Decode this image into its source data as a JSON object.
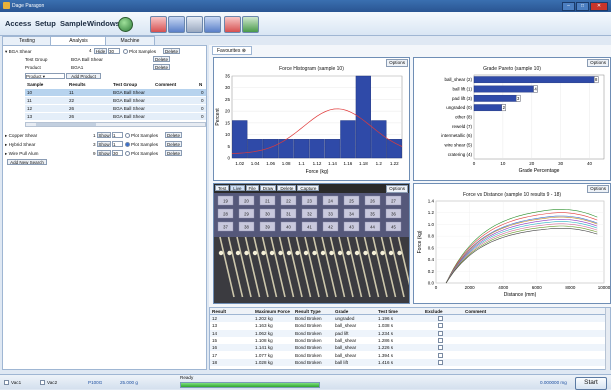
{
  "window": {
    "title": "Dage Paragon"
  },
  "menu": {
    "access": "Access",
    "setup": "Setup",
    "sample": "Sample",
    "windows": "Windows"
  },
  "tabs": {
    "testing": "Testing",
    "analysis": "Analysis",
    "machine": "Machine"
  },
  "left": {
    "group1": {
      "name": "BGA Shear",
      "count": "4",
      "hide_label": "Hide",
      "hide_value": "30",
      "plot_label": "Plot Samples",
      "delete_label": "Delete"
    },
    "test_group_label": "Test Group",
    "test_group_value": "BGA Ball Shear",
    "product_label": "Product",
    "product_value": "BGA1",
    "product_dropdown": "Product",
    "add_product": "Add Product",
    "table_headers": [
      "Sample",
      "Results",
      "Test Group",
      "Comment",
      "N"
    ],
    "rows": [
      {
        "sample": "10",
        "results": "11",
        "group": "BGA Ball Shear",
        "n": "0"
      },
      {
        "sample": "11",
        "results": "22",
        "group": "BGA Ball Shear",
        "n": "0"
      },
      {
        "sample": "12",
        "results": "26",
        "group": "BGA Ball Shear",
        "n": "0"
      },
      {
        "sample": "13",
        "results": "26",
        "group": "BGA Ball Shear",
        "n": "0"
      }
    ],
    "groups": [
      {
        "name": "Copper Shear",
        "count": "1",
        "show": "Show",
        "value": "1",
        "plot": "Plot Samples",
        "delete": "Delete"
      },
      {
        "name": "Hybrid Shear",
        "count": "3",
        "show": "Show",
        "value": "1",
        "plot": "Plot Samples",
        "delete": "Delete"
      },
      {
        "name": "Wire Pull Alum",
        "count": "9",
        "show": "Show",
        "value": "30",
        "plot": "Plot Samples",
        "delete": "Delete"
      }
    ],
    "add_new_search": "Add New Search"
  },
  "favourites_tab": "Favourites",
  "options_label": "Options",
  "hist": {
    "title": "Force Histogram (sample 10)",
    "xlabel": "Force (kg)",
    "ylabel": "Percent"
  },
  "pareto": {
    "title": "Grade Pareto (sample 10)",
    "xlabel": "Grade Percentage"
  },
  "fvd": {
    "title": "Force vs Distance (sample 10 results 9 - 18)",
    "xlabel": "Distance (mm)",
    "ylabel": "Force (kg)"
  },
  "image_toolbar": [
    "Test",
    "Live",
    "File",
    "Draw",
    "Delete",
    "Capture"
  ],
  "image_labels": [
    "19",
    "20",
    "21",
    "22",
    "23",
    "24",
    "25",
    "26",
    "27",
    "28",
    "29",
    "30",
    "31",
    "32",
    "33",
    "34",
    "35",
    "36",
    "37",
    "38",
    "39",
    "40",
    "41",
    "42",
    "43",
    "44",
    "45"
  ],
  "chart_data": [
    {
      "type": "bar",
      "title": "Force Histogram (sample 10)",
      "xlabel": "Force (kg)",
      "ylabel": "Percent",
      "x": [
        1.02,
        1.04,
        1.06,
        1.08,
        1.1,
        1.12,
        1.14,
        1.16,
        1.18,
        1.2,
        1.22
      ],
      "values": [
        16,
        8,
        8,
        8,
        8,
        8,
        8,
        16,
        35,
        16,
        8
      ],
      "ylim": [
        0,
        35
      ],
      "xlim": [
        1.02,
        1.22
      ],
      "yticks": [
        0,
        5,
        10,
        15,
        20,
        25,
        30,
        35
      ],
      "xtick_labels": [
        "1.02",
        "1.04",
        "1.06",
        "1.08",
        "1.1",
        "1.12",
        "1.14",
        "1.16",
        "1.18",
        "1.2",
        "1.22"
      ],
      "curve_color": "#e03a3a",
      "bar_color": "#2f4aa8"
    },
    {
      "type": "bar",
      "orientation": "horizontal",
      "title": "Grade Pareto (sample 10)",
      "xlabel": "Grade Percentage",
      "categories": [
        "ball_shear (2)",
        "ball lift (1)",
        "pad lift (3)",
        "ungraded (0)",
        "other (8)",
        "reweld (7)",
        "intermetallic (6)",
        "wire shear (5)",
        "cratering (4)"
      ],
      "values": [
        8,
        4,
        3,
        2,
        0,
        0,
        0,
        0,
        0
      ],
      "bar_values_percent": [
        43,
        22,
        16,
        11,
        0,
        0,
        0,
        0,
        0
      ],
      "xlim": [
        0,
        45
      ],
      "xticks": [
        0,
        10,
        20,
        30,
        40
      ],
      "bar_color": "#2f4aa8"
    },
    {
      "type": "line",
      "title": "Force vs Distance (sample 10 results 9 - 18)",
      "xlabel": "Distance (mm)",
      "ylabel": "Force (kg)",
      "xlim": [
        0,
        10000
      ],
      "ylim": [
        0,
        1.4
      ],
      "xticks": [
        0,
        2000,
        4000,
        6000,
        8000,
        10000
      ],
      "yticks": [
        0,
        0.2,
        0.4,
        0.6,
        0.8,
        1.0,
        1.2,
        1.4
      ],
      "series": [
        {
          "color": "#2a8f2a",
          "peak": 1.32
        },
        {
          "color": "#e03a3a",
          "peak": 1.26
        },
        {
          "color": "#3a6fd0",
          "peak": 1.2
        },
        {
          "color": "#c08a2a",
          "peak": 1.18
        },
        {
          "color": "#8a3ac0",
          "peak": 1.14
        },
        {
          "color": "#2ab0c0",
          "peak": 1.1
        },
        {
          "color": "#d06a9a",
          "peak": 1.06
        },
        {
          "color": "#6a9a2a",
          "peak": 1.02
        },
        {
          "color": "#444444",
          "peak": 0.98
        }
      ]
    }
  ],
  "results": {
    "headers": [
      "Result",
      "Maximum Force",
      "Result Type",
      "Grade",
      "Test time",
      "Exclude",
      "Comment"
    ],
    "rows": [
      {
        "result": "12",
        "force": "1.202 kg",
        "type": "Bond Broken",
        "grade": "ungraded",
        "time": "1.196 s"
      },
      {
        "result": "13",
        "force": "1.163 kg",
        "type": "Bond Broken",
        "grade": "ball_shear",
        "time": "1.038 s"
      },
      {
        "result": "14",
        "force": "1.062 kg",
        "type": "Bond Broken",
        "grade": "pad lift",
        "time": "1.234 s"
      },
      {
        "result": "15",
        "force": "1.108 kg",
        "type": "Bond Broken",
        "grade": "ball_shear",
        "time": "1.286 s"
      },
      {
        "result": "16",
        "force": "1.141 kg",
        "type": "Bond Broken",
        "grade": "ball_shear",
        "time": "1.226 s"
      },
      {
        "result": "17",
        "force": "1.077 kg",
        "type": "Bond Broken",
        "grade": "ball_shear",
        "time": "1.394 s"
      },
      {
        "result": "18",
        "force": "1.028 kg",
        "type": "Bond Broken",
        "grade": "ball lift",
        "time": "1.416 s"
      }
    ]
  },
  "status": {
    "vac1": "Vac1",
    "vac2": "Vac2",
    "cartridge": "P100G",
    "load": "25.000 g",
    "ready": "Ready",
    "reading": "0.000000 mg",
    "start": "Start"
  }
}
